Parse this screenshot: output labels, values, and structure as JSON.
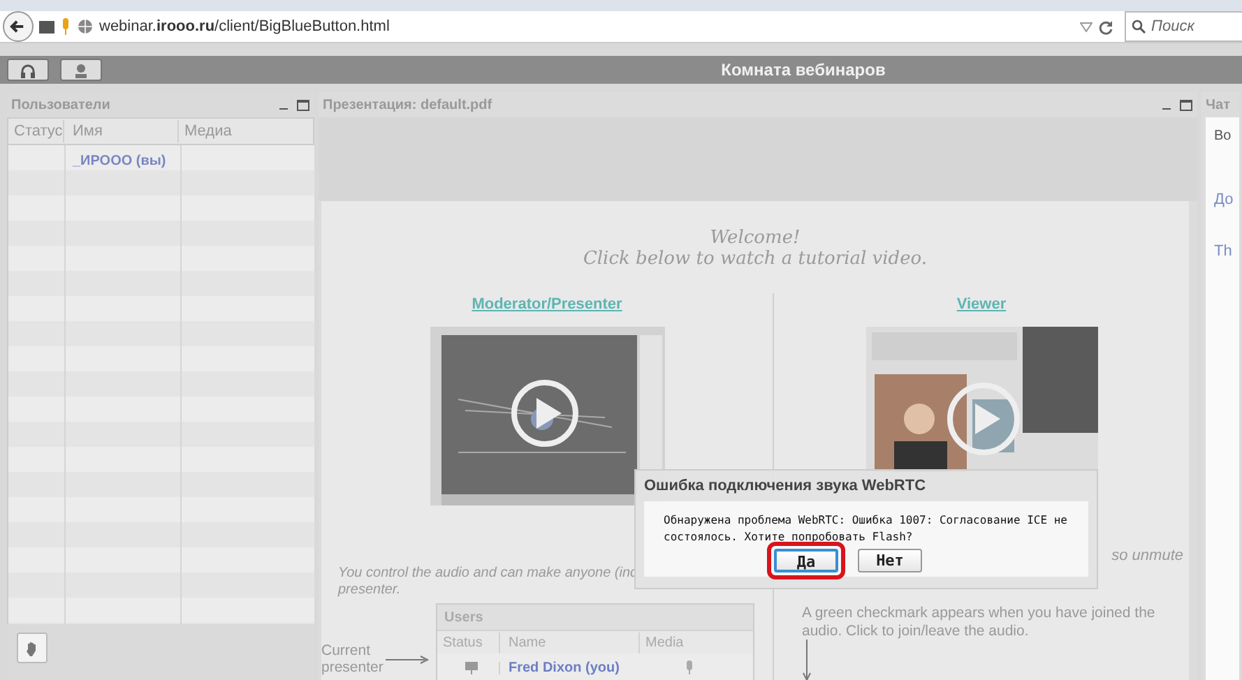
{
  "browser": {
    "url": "webinar.**irooo.ru**/client/BigBlueButton.html",
    "search_placeholder": "Поиск"
  },
  "app": {
    "title": "Комната вебинаров"
  },
  "users_panel": {
    "title": "Пользователи",
    "columns": [
      "Статус",
      "Имя",
      "Медиа"
    ],
    "rows": [
      {
        "name": "_ИРООО (вы)"
      }
    ]
  },
  "presentation": {
    "title": "Презентация: default.pdf",
    "welcome": [
      "Welcome!",
      "Click below to watch a tutorial video."
    ],
    "links": [
      "Moderator/Presenter",
      "Viewer"
    ],
    "left_text": [
      "You control the audio and can make anyone (inc",
      "presenter."
    ],
    "right_text_fragment": "so unmute",
    "right_note": "A green checkmark appears when you have joined the audio.  Click to join/leave the audio.",
    "current_presenter": "Current presenter",
    "mini_users": {
      "title": "Users",
      "columns": [
        "Status",
        "Name",
        "Media"
      ],
      "rows": [
        {
          "name": "Fred Dixon (you)"
        }
      ]
    }
  },
  "chat_panel": {
    "title": "Чат",
    "tab": "Во",
    "lines": [
      "До",
      "Th"
    ]
  },
  "dialog": {
    "title": "Ошибка подключения звука WebRTC",
    "message": "Обнаружена проблема WebRTC: Ошибка 1007: Согласование ICE не состоялось. Хотите попробовать Flash?",
    "buttons": [
      {
        "label": "Да",
        "focused": true,
        "highlighted": true
      },
      {
        "label": "Нет",
        "focused": false,
        "highlighted": false
      }
    ]
  }
}
